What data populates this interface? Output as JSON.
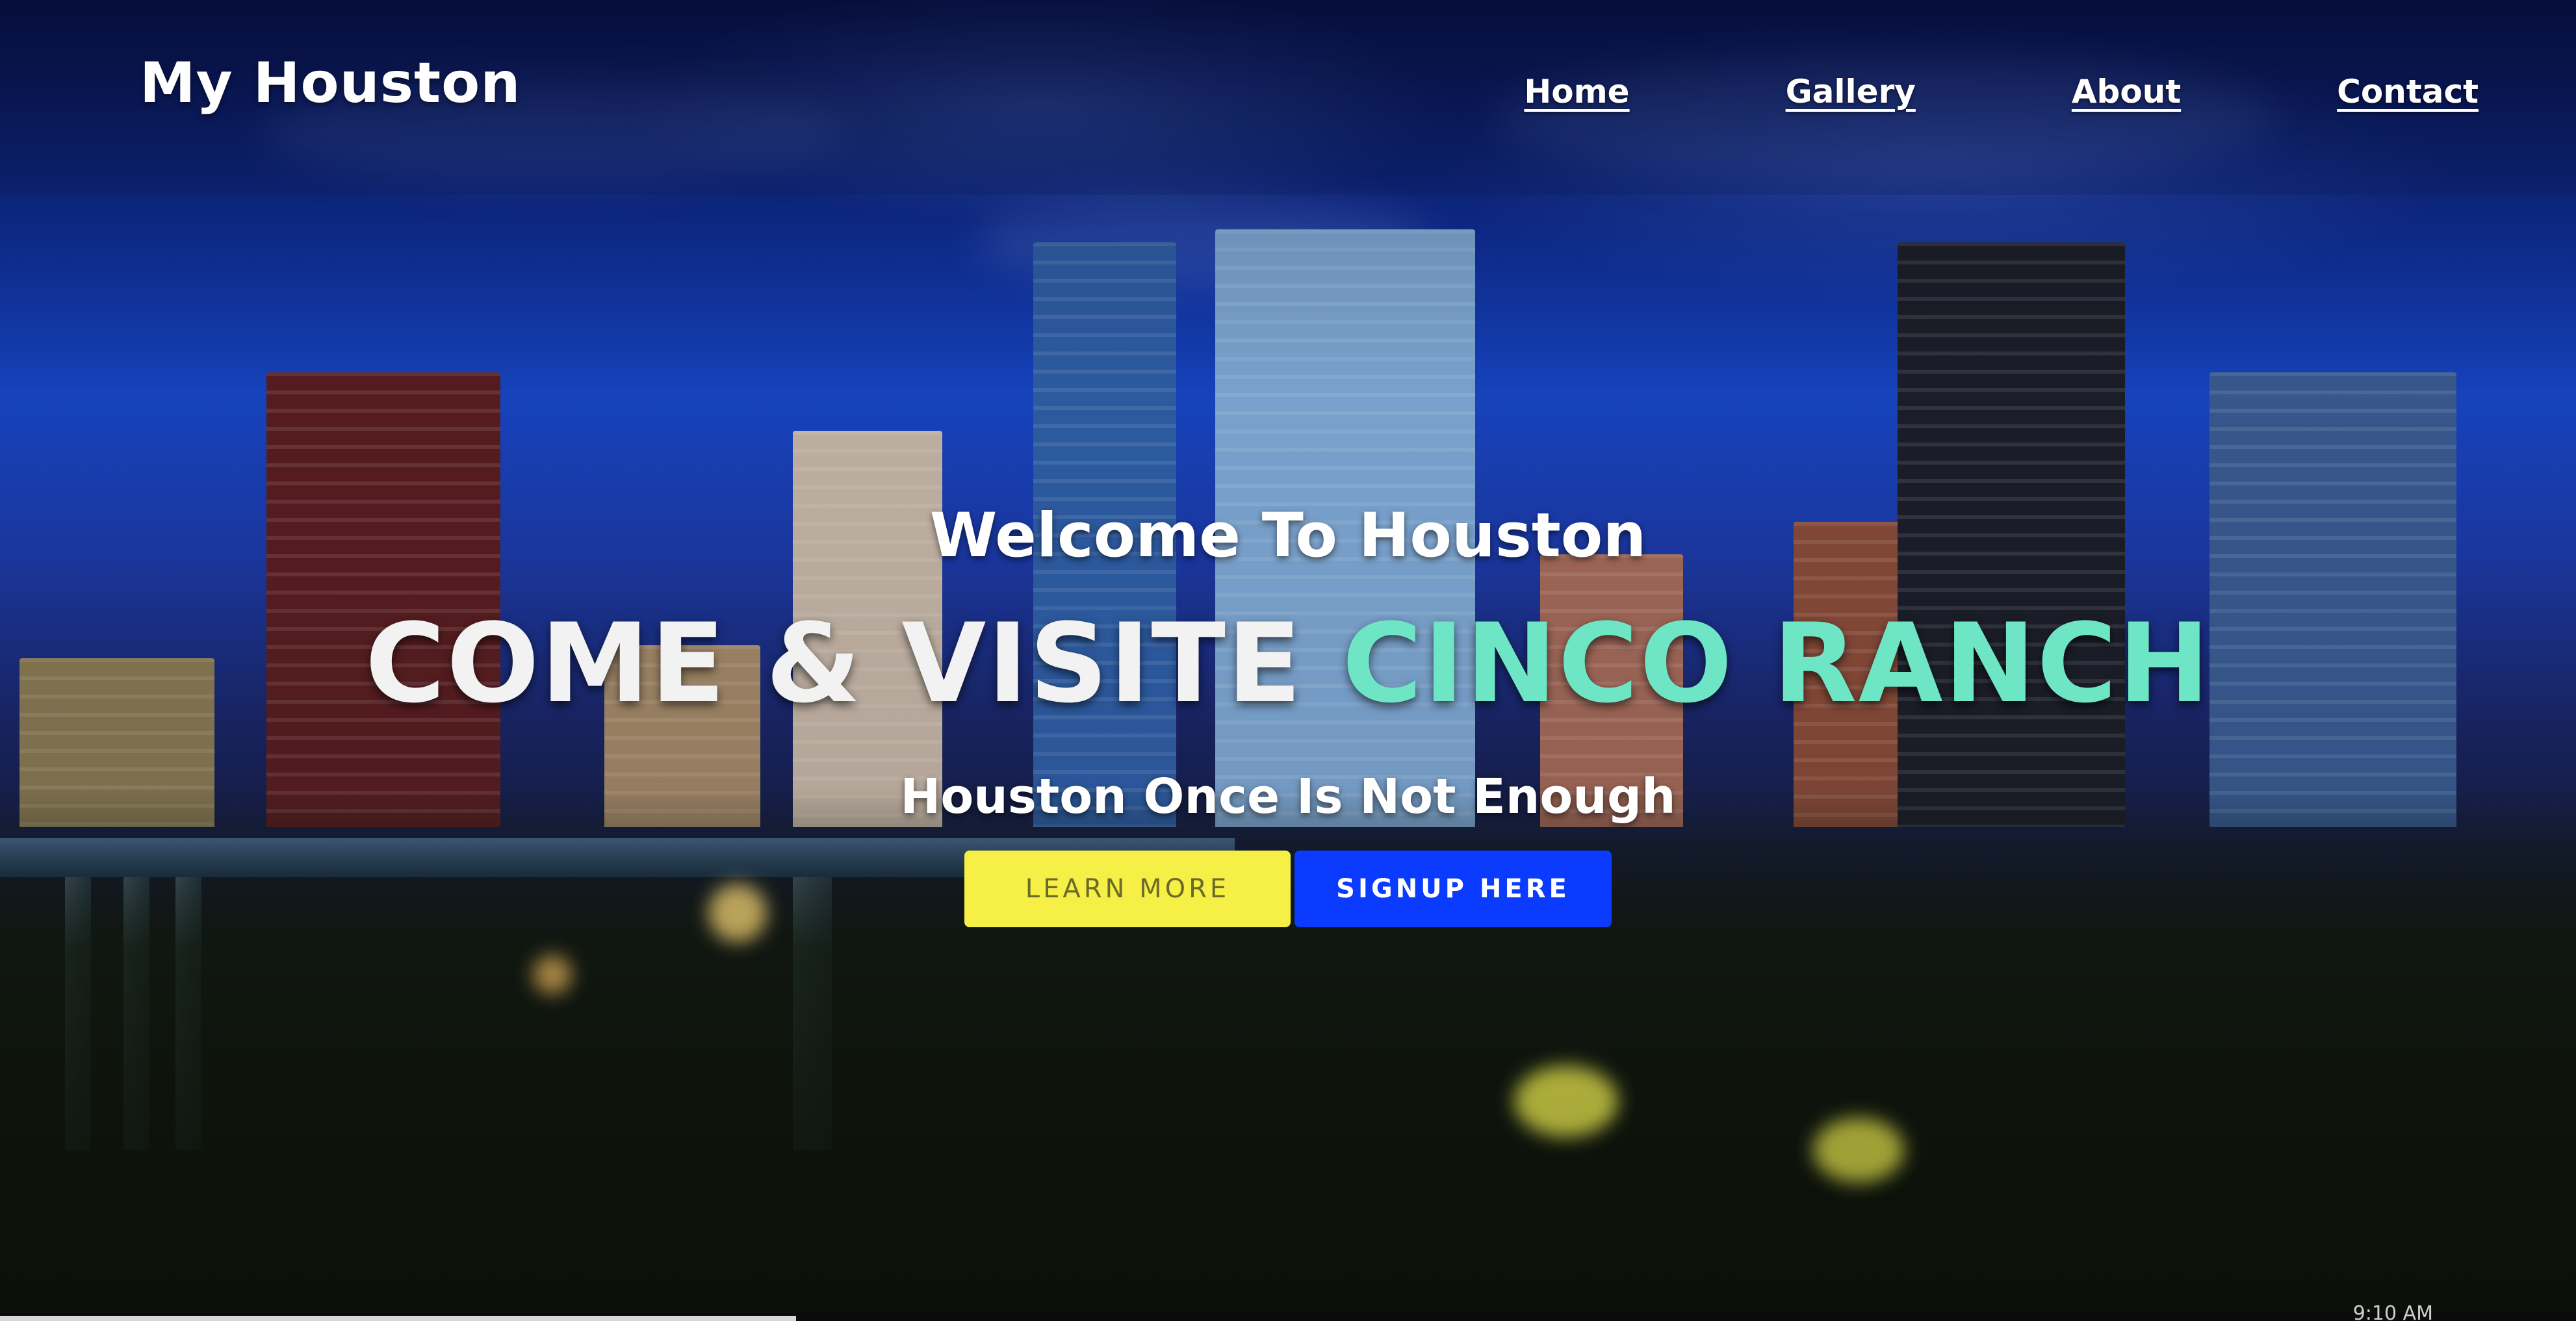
{
  "header": {
    "brand": "My Houston",
    "nav": [
      {
        "label": "Home"
      },
      {
        "label": "Gallery"
      },
      {
        "label": "About"
      },
      {
        "label": "Contact"
      }
    ]
  },
  "hero": {
    "welcome": "Welcome To Houston",
    "headline_plain": "COME & VISITE",
    "headline_accent": "CINCO RANCH",
    "tagline": "Houston Once Is Not Enough",
    "learn_more_label": "LEARN MORE",
    "signup_label": "SIGNUP HERE"
  },
  "taskbar": {
    "clock": "9:10 AM"
  },
  "colors": {
    "accent": "#6ee6c6",
    "learn_more_bg": "#f6ef45",
    "signup_bg": "#0a3bff"
  }
}
